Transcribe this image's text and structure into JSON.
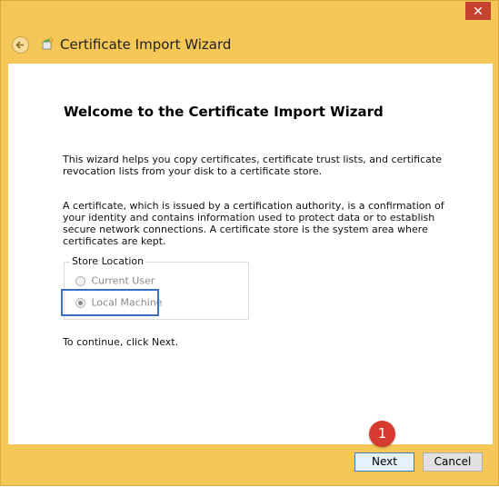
{
  "window": {
    "close_label": "✕",
    "title": "Certificate Import Wizard"
  },
  "wizard": {
    "heading": "Welcome to the Certificate Import Wizard",
    "intro": "This wizard helps you copy certificates, certificate trust lists, and certificate revocation lists from your disk to a certificate store.",
    "description": "A certificate, which is issued by a certification authority, is a confirmation of your identity and contains information used to protect data or to establish secure network connections. A certificate store is the system area where certificates are kept.",
    "store_location": {
      "legend": "Store Location",
      "options": [
        {
          "label": "Current User",
          "selected": false
        },
        {
          "label": "Local Machine",
          "selected": true
        }
      ]
    },
    "continue_text": "To continue, click Next."
  },
  "buttons": {
    "next": "Next",
    "cancel": "Cancel"
  },
  "annotation": {
    "step_number": "1"
  },
  "colors": {
    "window_frame": "#f5c757",
    "highlight_border": "#3c6fc1",
    "badge": "#d63b2f",
    "close_button": "#c7412f"
  },
  "icons": {
    "back": "back-arrow-icon",
    "wizard": "certificate-wizard-icon",
    "close": "close-icon"
  }
}
